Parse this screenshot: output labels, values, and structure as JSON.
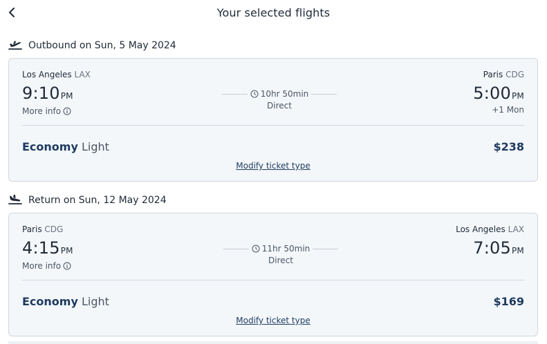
{
  "header": {
    "title": "Your selected flights"
  },
  "outbound": {
    "section_label": "Outbound on Sun, 5 May 2024",
    "departure": {
      "city": "Los Angeles",
      "code": "LAX",
      "time": "9:10",
      "ampm": "PM"
    },
    "arrival": {
      "city": "Paris",
      "code": "CDG",
      "time": "5:00",
      "ampm": "PM",
      "day_offset": "+1 Mon"
    },
    "more_info": "More info",
    "duration": "10hr 50min",
    "stops": "Direct",
    "fare_class": "Economy",
    "fare_type": "Light",
    "price": "$238",
    "modify_link": "Modify ticket type"
  },
  "return": {
    "section_label": "Return on Sun, 12 May 2024",
    "departure": {
      "city": "Paris",
      "code": "CDG",
      "time": "4:15",
      "ampm": "PM"
    },
    "arrival": {
      "city": "Los Angeles",
      "code": "LAX",
      "time": "7:05",
      "ampm": "PM"
    },
    "more_info": "More info",
    "duration": "11hr 50min",
    "stops": "Direct",
    "fare_class": "Economy",
    "fare_type": "Light",
    "price": "$169",
    "modify_link": "Modify ticket type"
  },
  "icons": {
    "back": "chevron-left-icon",
    "outbound": "plane-departure-icon",
    "return": "plane-arrival-icon",
    "info": "info-circle-icon",
    "clock": "clock-icon"
  },
  "colors": {
    "card_bg": "#f3f7fa",
    "card_border": "#cfd6dd",
    "accent": "#1e3a5f"
  }
}
